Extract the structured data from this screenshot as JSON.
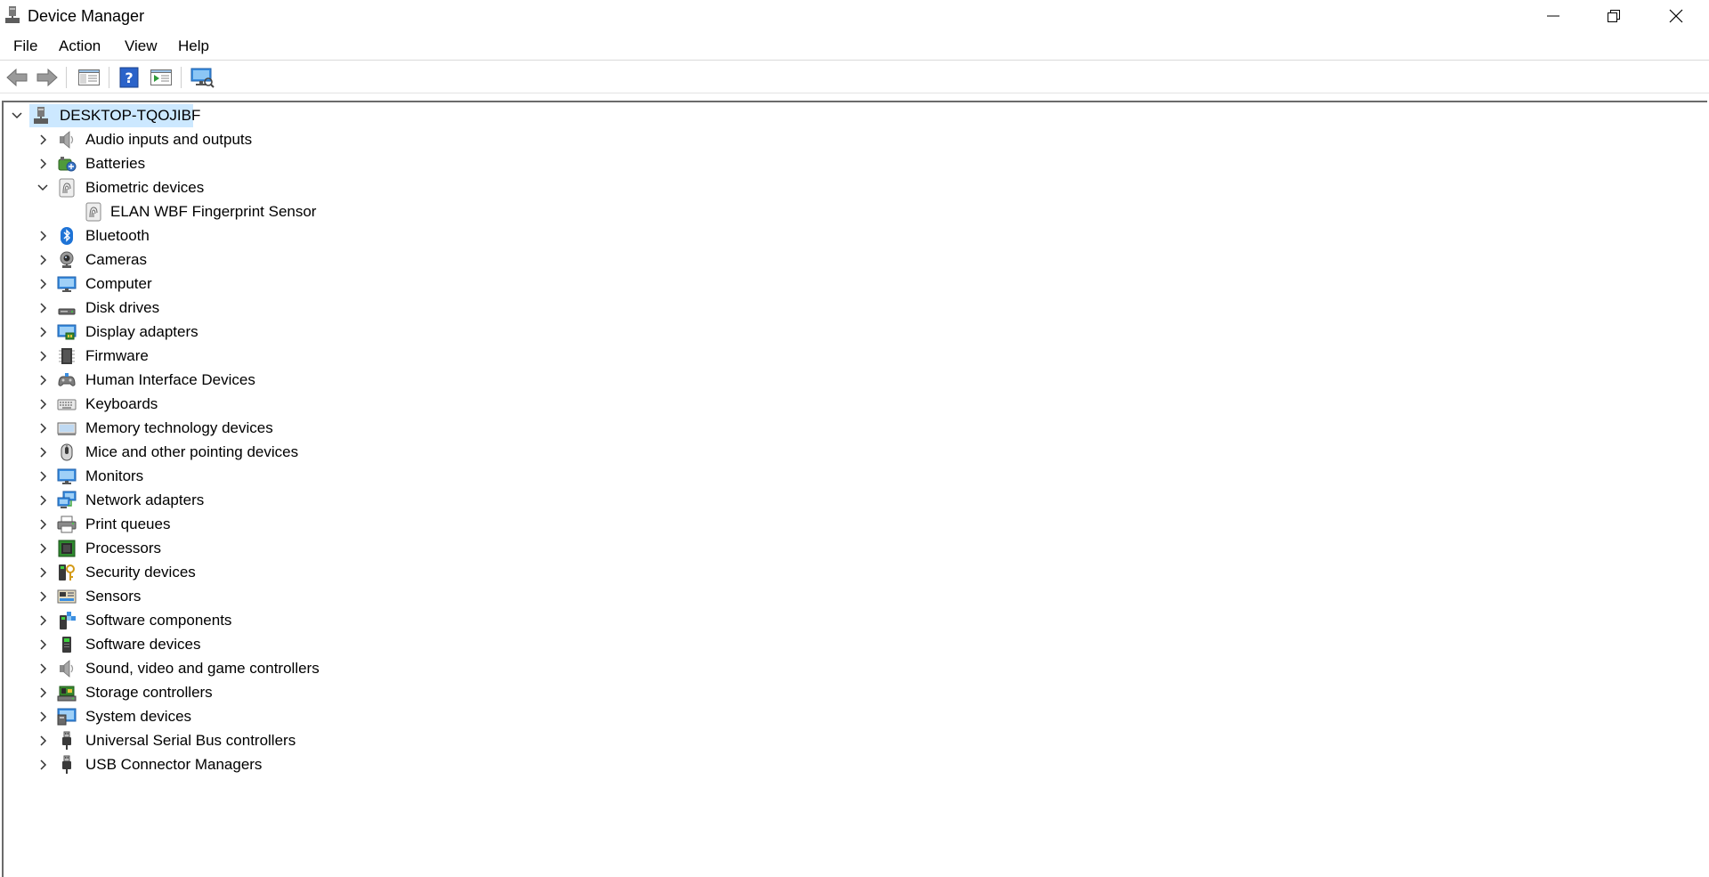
{
  "window": {
    "title": "Device Manager"
  },
  "menu": {
    "items": [
      "File",
      "Action",
      "View",
      "Help"
    ]
  },
  "toolbar": {
    "buttons": [
      "back-arrow-icon",
      "forward-arrow-icon",
      "show-hide-console-tree-icon",
      "help-icon",
      "properties-icon",
      "scan-hardware-icon"
    ]
  },
  "tree": {
    "root": {
      "label": "DESKTOP-TQOJIBF",
      "icon": "computer-root-icon",
      "expanded": true,
      "selected": true
    },
    "categories": [
      {
        "label": "Audio inputs and outputs",
        "icon": "speaker-icon",
        "expanded": false
      },
      {
        "label": "Batteries",
        "icon": "battery-icon",
        "expanded": false
      },
      {
        "label": "Biometric devices",
        "icon": "fingerprint-icon",
        "expanded": true,
        "children": [
          {
            "label": "ELAN WBF Fingerprint Sensor",
            "icon": "fingerprint-icon"
          }
        ]
      },
      {
        "label": "Bluetooth",
        "icon": "bluetooth-icon",
        "expanded": false
      },
      {
        "label": "Cameras",
        "icon": "camera-icon",
        "expanded": false
      },
      {
        "label": "Computer",
        "icon": "computer-icon",
        "expanded": false
      },
      {
        "label": "Disk drives",
        "icon": "disk-drive-icon",
        "expanded": false
      },
      {
        "label": "Display adapters",
        "icon": "display-adapter-icon",
        "expanded": false
      },
      {
        "label": "Firmware",
        "icon": "firmware-icon",
        "expanded": false
      },
      {
        "label": "Human Interface Devices",
        "icon": "hid-icon",
        "expanded": false
      },
      {
        "label": "Keyboards",
        "icon": "keyboard-icon",
        "expanded": false
      },
      {
        "label": "Memory technology devices",
        "icon": "memory-icon",
        "expanded": false
      },
      {
        "label": "Mice and other pointing devices",
        "icon": "mouse-icon",
        "expanded": false
      },
      {
        "label": "Monitors",
        "icon": "monitor-icon",
        "expanded": false
      },
      {
        "label": "Network adapters",
        "icon": "network-adapter-icon",
        "expanded": false
      },
      {
        "label": "Print queues",
        "icon": "printer-icon",
        "expanded": false
      },
      {
        "label": "Processors",
        "icon": "processor-icon",
        "expanded": false
      },
      {
        "label": "Security devices",
        "icon": "security-key-icon",
        "expanded": false
      },
      {
        "label": "Sensors",
        "icon": "sensor-icon",
        "expanded": false
      },
      {
        "label": "Software components",
        "icon": "software-component-icon",
        "expanded": false
      },
      {
        "label": "Software devices",
        "icon": "software-device-icon",
        "expanded": false
      },
      {
        "label": "Sound, video and game controllers",
        "icon": "speaker-icon",
        "expanded": false
      },
      {
        "label": "Storage controllers",
        "icon": "storage-controller-icon",
        "expanded": false
      },
      {
        "label": "System devices",
        "icon": "system-device-icon",
        "expanded": false
      },
      {
        "label": "Universal Serial Bus controllers",
        "icon": "usb-icon",
        "expanded": false
      },
      {
        "label": "USB Connector Managers",
        "icon": "usb-icon",
        "expanded": false
      }
    ]
  },
  "colors": {
    "selection": "#cce8ff",
    "accent": "#1e73d6"
  }
}
